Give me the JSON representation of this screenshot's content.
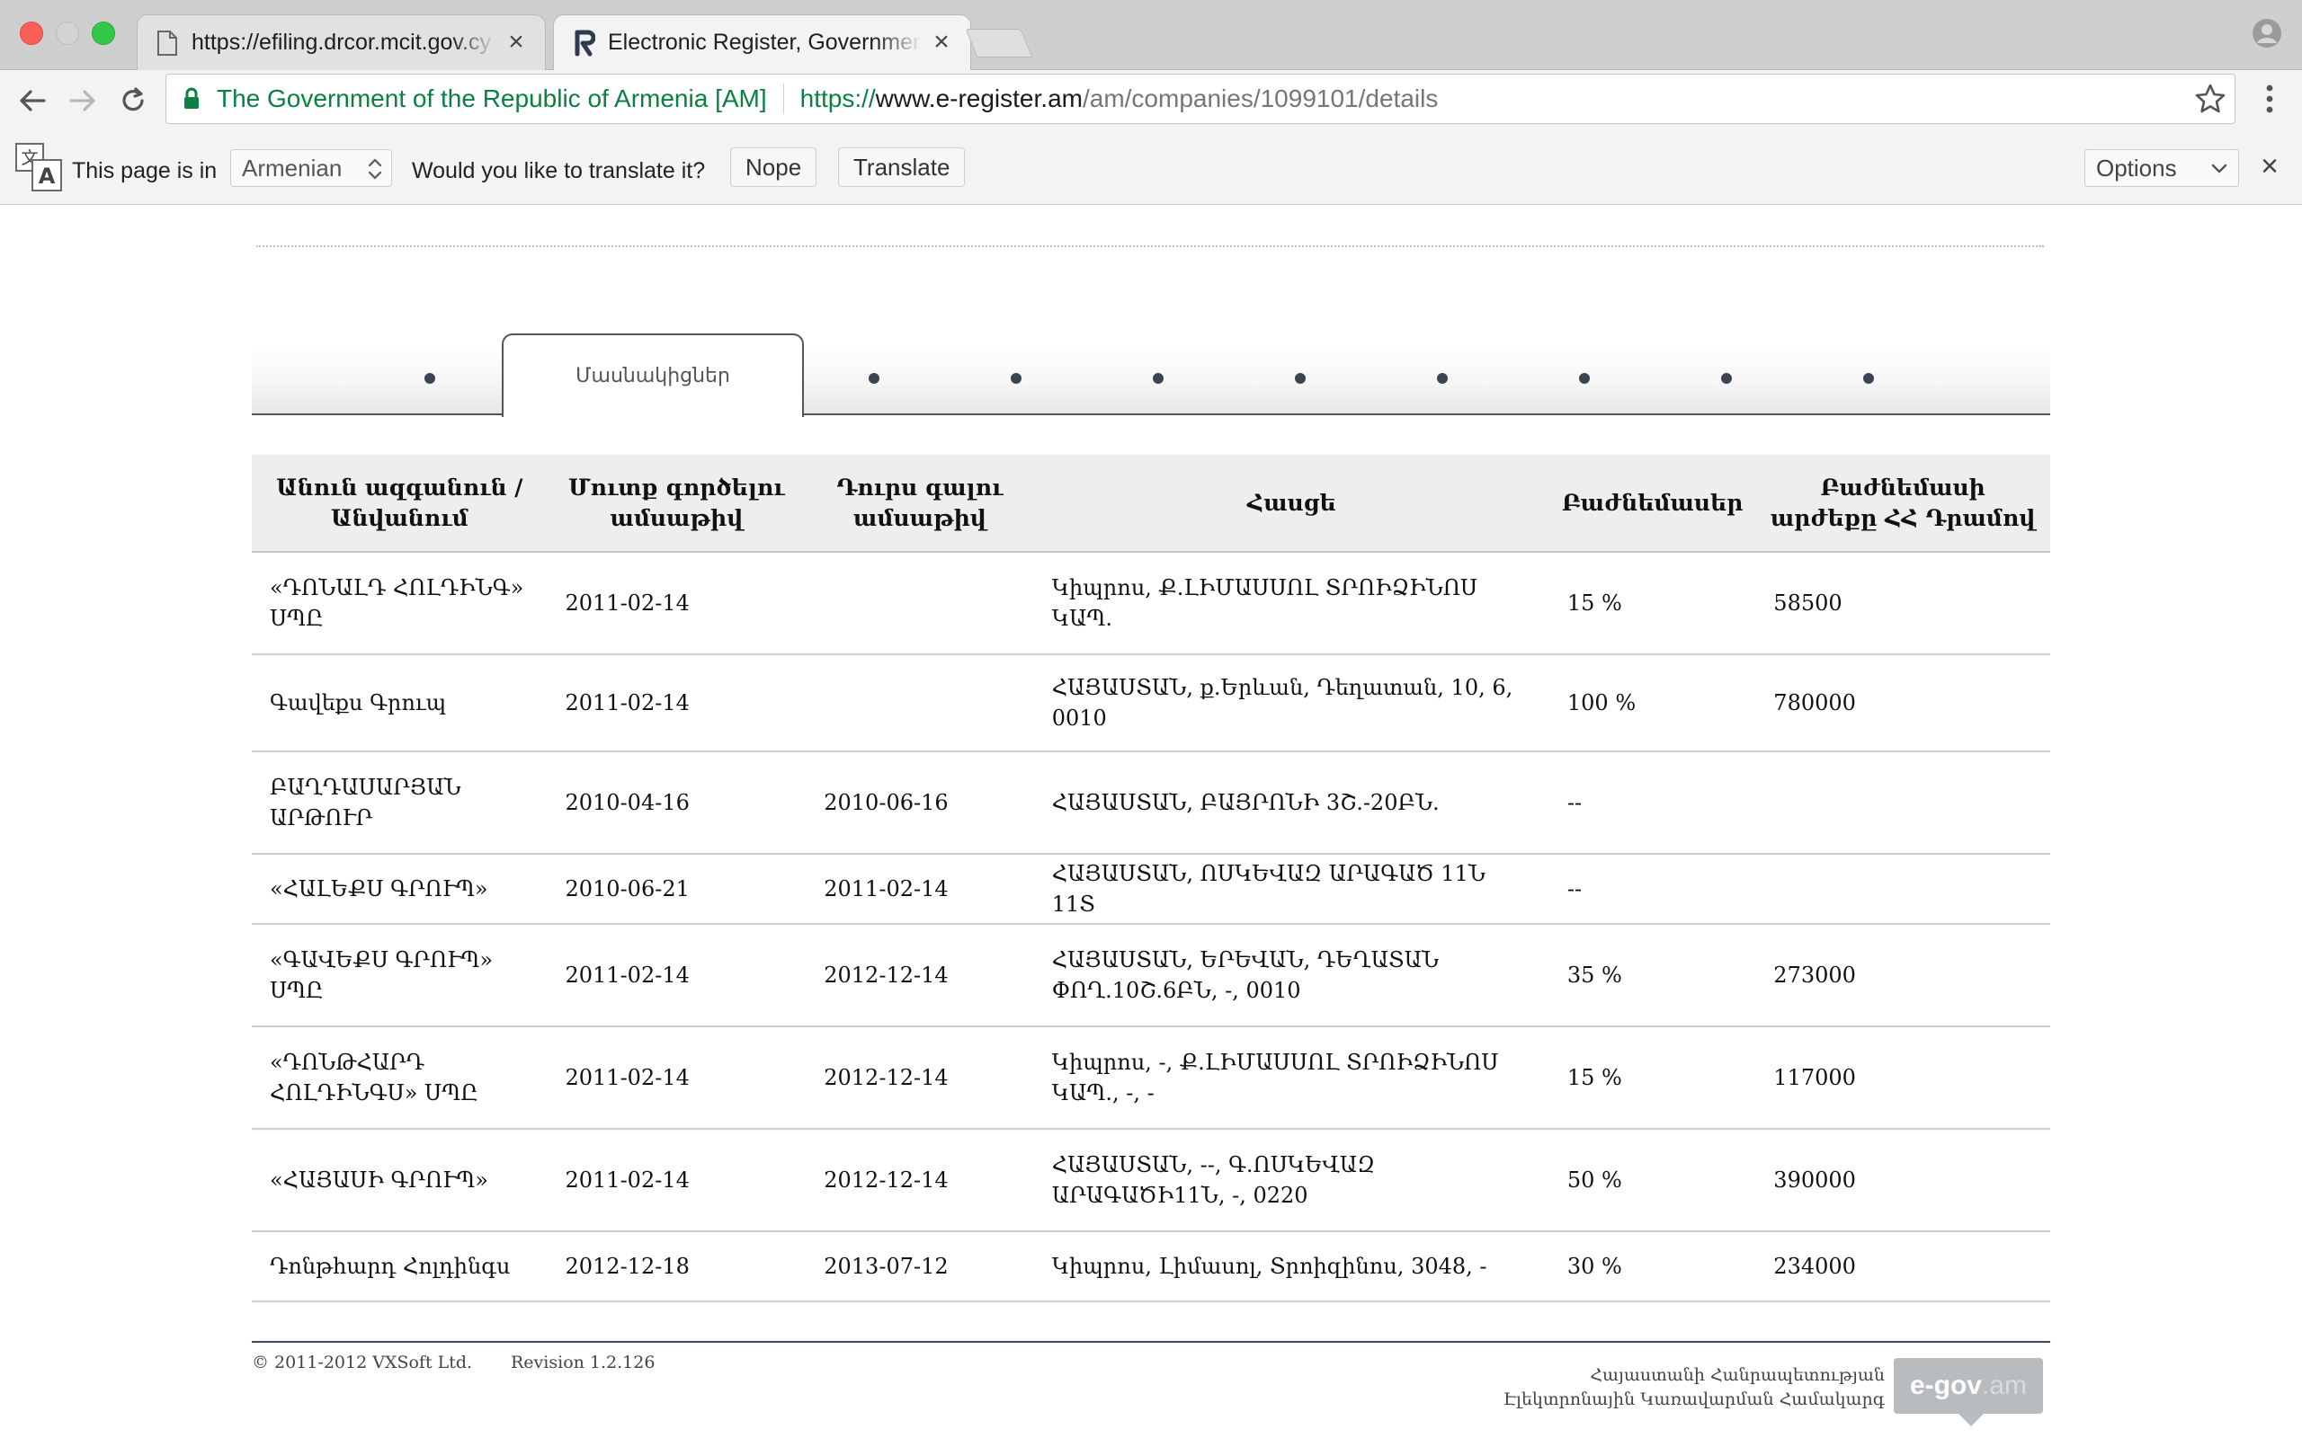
{
  "browser": {
    "tabs": [
      {
        "title": "https://efiling.drcor.mcit.gov.cy",
        "active": false
      },
      {
        "title": "Electronic Register, Government",
        "active": true
      }
    ],
    "address": {
      "ev_label": "The Government of the Republic of Armenia [AM]",
      "scheme": "https://",
      "host": "www.e-register.am",
      "path": "/am/companies/1099101/details"
    }
  },
  "translate_bar": {
    "this_page_is_in": "This page is in",
    "language": "Armenian",
    "question": "Would you like to translate it?",
    "nope": "Nope",
    "translate": "Translate",
    "options": "Options"
  },
  "page": {
    "active_tab": "Մասնակիցներ",
    "table": {
      "headers": [
        "Անուն ազգանուն / Անվանում",
        "Մուտք գործելու ամսաթիվ",
        "Դուրս գալու ամսաթիվ",
        "Հասցե",
        "Բաժնեմասեր",
        "Բաժնեմասի արժեքը ՀՀ Դրամով"
      ],
      "rows": [
        {
          "name": "«ԴՈՆԱԼԴ ՀՈԼԴԻՆԳ» ՍՊԸ",
          "entry": "2011-02-14",
          "exit": "",
          "address": "Կիպրոս, Ք.ԼԻՄԱՍՍՈԼ ՏՐՈԻՁԻՆՈՍ ԿԱՊ.",
          "share": "15 %",
          "value": "58500"
        },
        {
          "name": "Գավեքս Գրուպ",
          "entry": "2011-02-14",
          "exit": "",
          "address": "ՀԱՅԱՍՏԱՆ, ք.Երևան, Դեղատան, 10, 6, 0010",
          "share": "100 %",
          "value": "780000"
        },
        {
          "name": "ԲԱՂԴԱՍԱՐՅԱՆ ԱՐԹՈՒՐ",
          "entry": "2010-04-16",
          "exit": "2010-06-16",
          "address": "ՀԱՅԱՍՏԱՆ, ԲԱՅՐՈՆԻ 3Շ.-20ԲՆ.",
          "share": "--",
          "value": ""
        },
        {
          "name": "«ՀԱԼԵՔՍ ԳՐՈՒՊ»",
          "entry": "2010-06-21",
          "exit": "2011-02-14",
          "address": "ՀԱՅԱՍՏԱՆ, ՈՍԿԵՎԱԶ ԱՐԱԳԱԾ 11Ն 11Տ",
          "share": "--",
          "value": ""
        },
        {
          "name": "«ԳԱՎԵՔՍ ԳՐՈՒՊ» ՍՊԸ",
          "entry": "2011-02-14",
          "exit": "2012-12-14",
          "address": "ՀԱՅԱՍՏԱՆ, ԵՐԵՎԱՆ, ԴԵՂԱՏԱՆ ՓՈՂ.10Շ.6ԲՆ, -, 0010",
          "share": "35 %",
          "value": "273000"
        },
        {
          "name": "«ԴՈՆԹՀԱՐԴ ՀՈԼԴԻՆԳՍ» ՍՊԸ",
          "entry": "2011-02-14",
          "exit": "2012-12-14",
          "address": "Կիպրոս, -, Ք.ԼԻՄԱՍՍՈԼ ՏՐՈԻՁԻՆՈՍ ԿԱՊ., -, -",
          "share": "15 %",
          "value": "117000"
        },
        {
          "name": "«ՀԱՅԱՍԻ ԳՐՈՒՊ»",
          "entry": "2011-02-14",
          "exit": "2012-12-14",
          "address": "ՀԱՅԱՍՏԱՆ, --, Գ.ՈՍԿԵՎԱԶ ԱՐԱԳԱԾԻ11Ն, -, 0220",
          "share": "50 %",
          "value": "390000"
        },
        {
          "name": "Դոնթհարդ Հոլդինգս",
          "entry": "2012-12-18",
          "exit": "2013-07-12",
          "address": "Կիպրոս, Լիմասոլ, Տրոիզինոս, 3048, -",
          "share": "30 %",
          "value": "234000"
        }
      ]
    },
    "footer": {
      "copyright": "© 2011-2012 VXSoft Ltd.",
      "revision": "Revision 1.2.126",
      "org_line1": "Հայաստանի Հանրապետության",
      "org_line2": "Էլեկտրոնային Կառավարման Համակարգ",
      "logo_main": "e-gov",
      "logo_suffix": ".am"
    }
  },
  "colors": {
    "ev_green": "#0b8043",
    "tab_dot": "#3c4452",
    "footer_rule": "#3d4a66",
    "logo_gray": "#b9bcbf"
  }
}
